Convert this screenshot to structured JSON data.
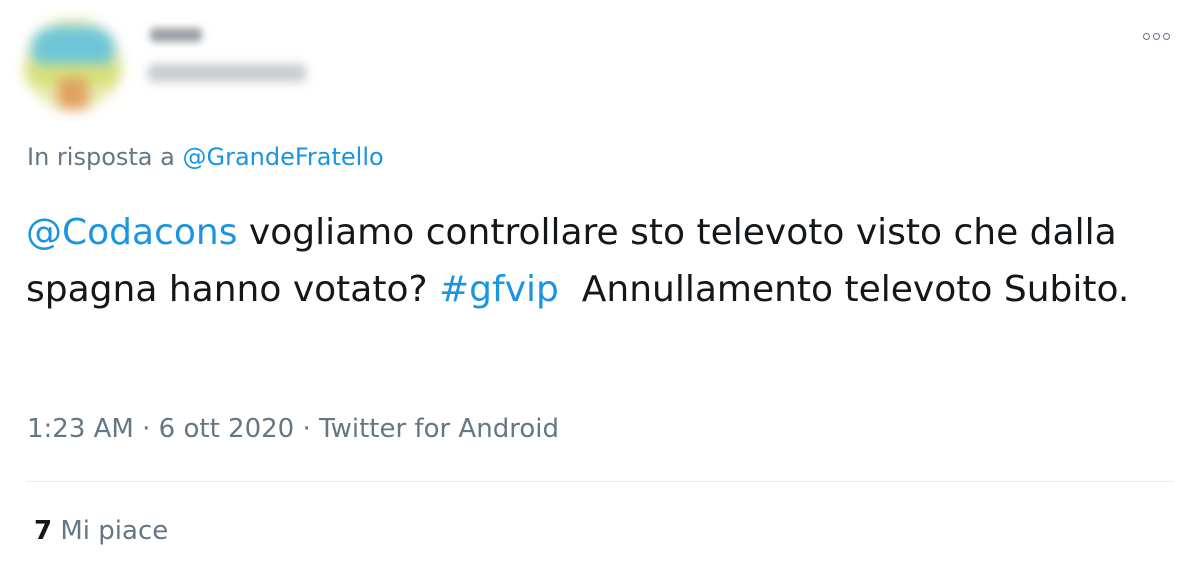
{
  "reply": {
    "prefix": "In risposta a",
    "handle": "@GrandeFratello"
  },
  "tweet": {
    "mention": "@Codacons",
    "text_part1": " vogliamo controllare sto televoto visto che dalla spagna hanno votato? ",
    "hashtag": "#gfvip",
    "text_part2": "  Annullamento televoto Subito."
  },
  "meta": {
    "time": "1:23 AM",
    "sep1": " · ",
    "date": "6 ott 2020",
    "sep2": " · ",
    "source": "Twitter for Android"
  },
  "likes": {
    "count": "7",
    "label": " Mi piace"
  },
  "colors": {
    "link": "#1b95e0",
    "secondary_text": "#657786",
    "primary_text": "#14171a"
  },
  "icons": {
    "more": "more-options-icon"
  }
}
